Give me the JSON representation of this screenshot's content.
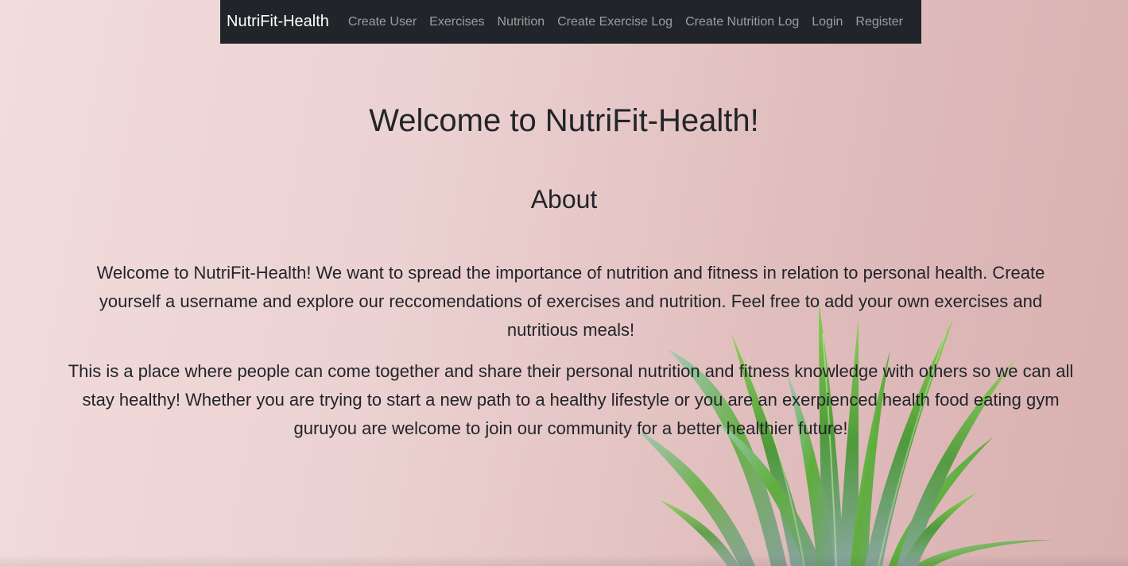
{
  "navbar": {
    "brand": "NutriFit-Health",
    "links": [
      {
        "label": "Create User"
      },
      {
        "label": "Exercises"
      },
      {
        "label": "Nutrition"
      },
      {
        "label": "Create Exercise Log"
      },
      {
        "label": "Create Nutrition Log"
      },
      {
        "label": "Login"
      },
      {
        "label": "Register"
      }
    ]
  },
  "main": {
    "title": "Welcome to NutriFit-Health!",
    "about_heading": "About",
    "paragraphs": [
      "Welcome to NutriFit-Health! We want to spread the importance of nutrition and fitness in relation to personal health. Create yourself a username and explore our reccomendations of exercises and nutrition. Feel free to add your own exercises and nutritious meals!",
      "This is a place where people can come together and share their personal nutrition and fitness knowledge with others so we can all stay healthy! Whether you are trying to start a new path to a healthy lifestyle or you are an exerpienced health food eating gym guruyou are welcome to join our community for a better healthier future!"
    ]
  },
  "colors": {
    "navbar_bg": "#212529",
    "background": "#ecd2d2",
    "plant_green": "#5fae3c"
  }
}
